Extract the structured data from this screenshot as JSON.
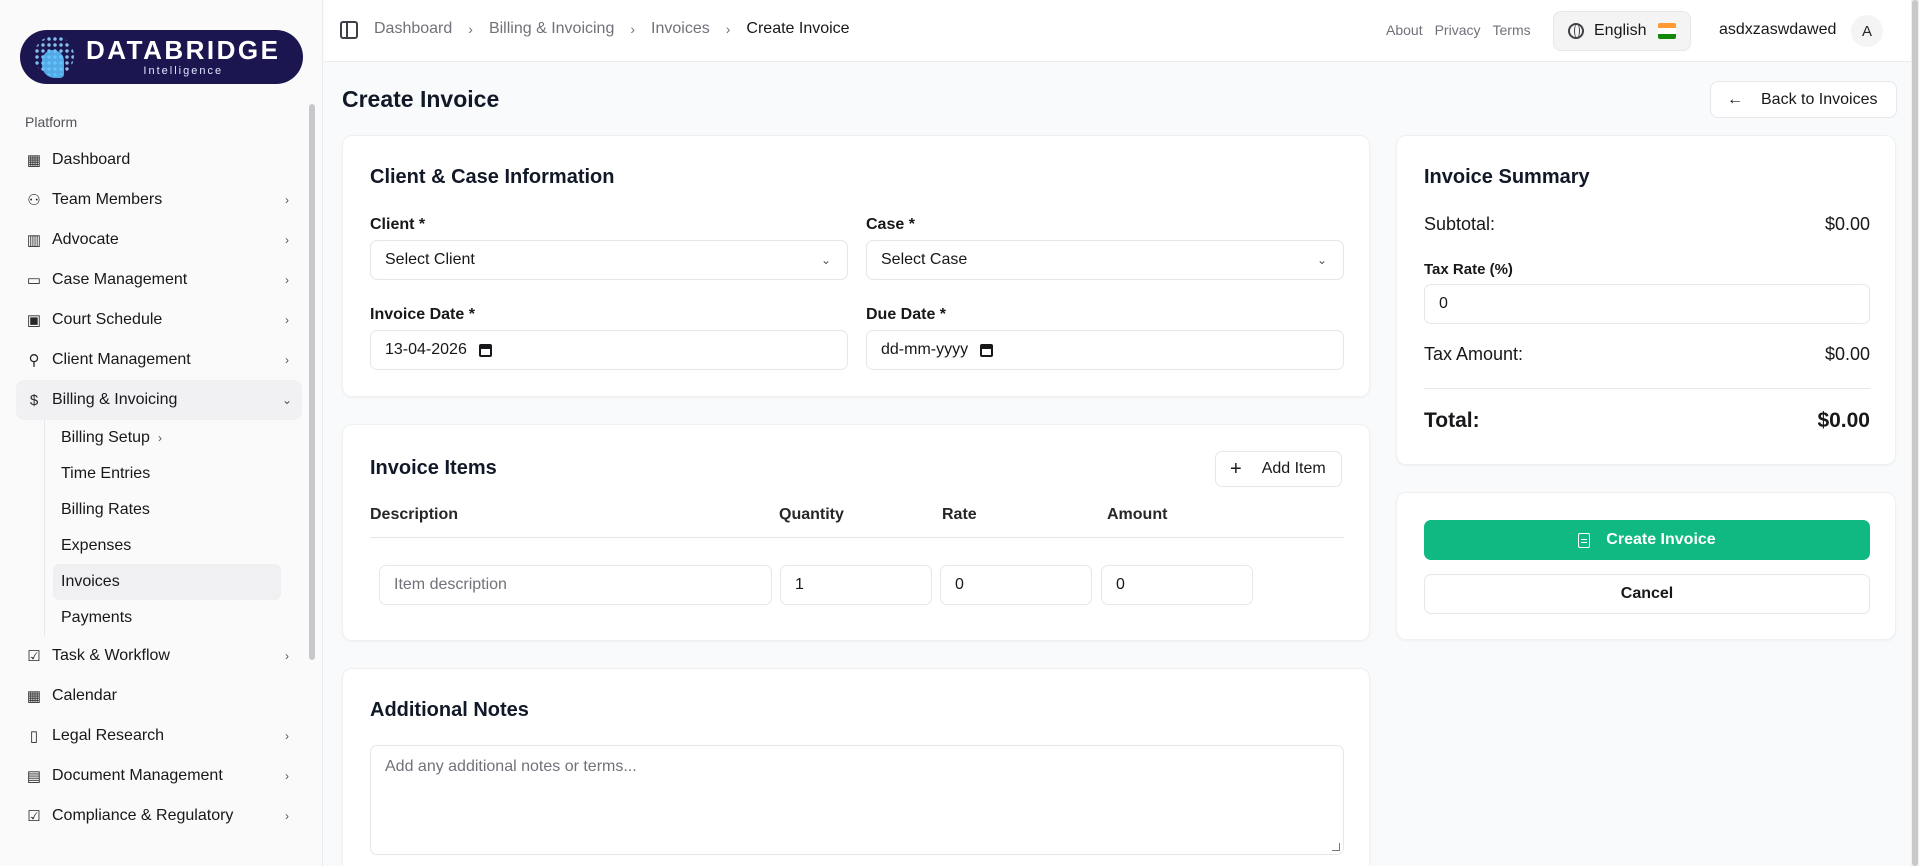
{
  "brand": {
    "name": "DATABRIDGE",
    "tagline": "Intelligence"
  },
  "sidebar": {
    "section": "Platform",
    "items": [
      {
        "label": "Dashboard",
        "icon": "dashboard-grid-icon"
      },
      {
        "label": "Team Members",
        "icon": "users-icon"
      },
      {
        "label": "Advocate",
        "icon": "building-icon"
      },
      {
        "label": "Case Management",
        "icon": "briefcase-icon"
      },
      {
        "label": "Court Schedule",
        "icon": "calendar-icon"
      },
      {
        "label": "Client Management",
        "icon": "user-check-icon"
      },
      {
        "label": "Billing & Invoicing",
        "icon": "dollar-icon"
      },
      {
        "label": "Task & Workflow",
        "icon": "checkbox-icon"
      },
      {
        "label": "Calendar",
        "icon": "calendar-days-icon"
      },
      {
        "label": "Legal Research",
        "icon": "book-icon"
      },
      {
        "label": "Document Management",
        "icon": "file-icon"
      },
      {
        "label": "Compliance & Regulatory",
        "icon": "check-square-icon"
      }
    ],
    "billing_sub": [
      "Billing Setup",
      "Time Entries",
      "Billing Rates",
      "Expenses",
      "Invoices",
      "Payments"
    ]
  },
  "header": {
    "breadcrumbs": [
      "Dashboard",
      "Billing & Invoicing",
      "Invoices",
      "Create Invoice"
    ],
    "links": [
      "About",
      "Privacy",
      "Terms"
    ],
    "language": "English",
    "username": "asdxzaswdawed",
    "avatar_letter": "A"
  },
  "page": {
    "title": "Create Invoice",
    "back_label": "Back to Invoices"
  },
  "client_case": {
    "title": "Client & Case Information",
    "client_label": "Client *",
    "client_value": "Select Client",
    "case_label": "Case *",
    "case_value": "Select Case",
    "invoice_date_label": "Invoice Date *",
    "invoice_date_value": "13-04-2026",
    "due_date_label": "Due Date *",
    "due_date_value": "dd-mm-yyyy"
  },
  "items": {
    "title": "Invoice Items",
    "add_label": "Add Item",
    "columns": [
      "Description",
      "Quantity",
      "Rate",
      "Amount"
    ],
    "row": {
      "description_placeholder": "Item description",
      "quantity": "1",
      "rate": "0",
      "amount": "0"
    }
  },
  "notes": {
    "title": "Additional Notes",
    "placeholder": "Add any additional notes or terms..."
  },
  "summary": {
    "title": "Invoice Summary",
    "subtotal_label": "Subtotal:",
    "subtotal_value": "$0.00",
    "tax_rate_label": "Tax Rate (%)",
    "tax_rate_value": "0",
    "tax_amount_label": "Tax Amount:",
    "tax_amount_value": "$0.00",
    "total_label": "Total:",
    "total_value": "$0.00"
  },
  "actions": {
    "create_label": "Create Invoice",
    "cancel_label": "Cancel"
  },
  "colors": {
    "primary": "#10b981",
    "logo_bg": "#1b1650"
  }
}
